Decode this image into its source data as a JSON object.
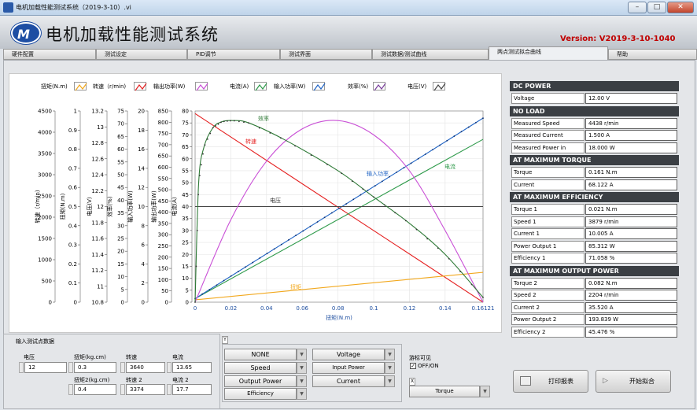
{
  "window": {
    "title": "电机加载性能测试系统（2019-3-10）.vi"
  },
  "header": {
    "title": "电机加载性能测试系统",
    "version": "Version: V2019-3-10-1040"
  },
  "tabs": [
    "硬件配置",
    "测试设定",
    "PID调节",
    "测试界面",
    "测试数据/测试曲线",
    "两点测试拟合曲线",
    "帮助"
  ],
  "legend": [
    "扭矩(N.m)",
    "转速（r/min)",
    "输出功率(W)",
    "电流(A)",
    "输入功率(W)",
    "效率(%)",
    "电压(V)"
  ],
  "axes": [
    {
      "label": "转速（r/min)",
      "ticks": [
        "4500",
        "4000",
        "3500",
        "3000",
        "2500",
        "2000",
        "1500",
        "1000",
        "500",
        "0"
      ]
    },
    {
      "label": "扭矩(N.m)",
      "ticks": [
        "1",
        "0.9",
        "0.8",
        "0.7",
        "0.6",
        "0.5",
        "0.4",
        "0.3",
        "0.2",
        "0.1",
        "0"
      ]
    },
    {
      "label": "电压(V)",
      "ticks": [
        "13.2",
        "13",
        "12.8",
        "12.6",
        "12.4",
        "12.2",
        "12",
        "11.8",
        "11.6",
        "11.4",
        "11.2",
        "11",
        "10.8"
      ]
    },
    {
      "label": "效率(%)",
      "ticks": [
        "75",
        "70",
        "65",
        "60",
        "55",
        "50",
        "45",
        "40",
        "35",
        "30",
        "25",
        "20",
        "15",
        "10",
        "5",
        "0"
      ]
    },
    {
      "label": "输入功率(W)",
      "ticks": [
        "20",
        "18",
        "16",
        "14",
        "12",
        "10",
        "8",
        "6",
        "4",
        "2",
        "0"
      ]
    },
    {
      "label": "输出功率(W)",
      "ticks": [
        "850",
        "800",
        "750",
        "700",
        "650",
        "600",
        "550",
        "500",
        "450",
        "400",
        "350",
        "300",
        "250",
        "200",
        "150",
        "100",
        "50",
        "0"
      ]
    },
    {
      "label": "电流(A)",
      "ticks": [
        "80",
        "75",
        "70",
        "65",
        "60",
        "55",
        "50",
        "45",
        "40",
        "35",
        "30",
        "25",
        "20",
        "15",
        "10",
        "5",
        "0"
      ]
    }
  ],
  "chart_data": {
    "type": "line",
    "xlabel": "扭矩(N.m)",
    "x_ticks": [
      "0",
      "0.02",
      "0.04",
      "0.06",
      "0.08",
      "0.1",
      "0.12",
      "0.14",
      "0.16121"
    ],
    "xlim": [
      0,
      0.16121
    ],
    "curve_labels": {
      "efficiency": "效率",
      "speed": "转速",
      "voltage": "电压",
      "input_power": "输入功率",
      "current": "电流",
      "torque": "扭矩"
    },
    "series": [
      {
        "key": "speed",
        "color": "#e52020",
        "axis": "转速（r/min)",
        "x": [
          0,
          0.16121
        ],
        "y": [
          4438,
          0
        ]
      },
      {
        "key": "current",
        "color": "#2e9a4a",
        "axis": "电流(A)",
        "x": [
          0,
          0.16121
        ],
        "y": [
          1.5,
          68.122
        ]
      },
      {
        "key": "input_power",
        "color": "#1f63c4",
        "axis": "电流(A)",
        "x": [
          0,
          0.16121
        ],
        "y": [
          1.5,
          77
        ]
      },
      {
        "key": "voltage",
        "color": "#444444",
        "axis": "电流(A)",
        "x": [
          0,
          0.16121
        ],
        "y": [
          40,
          40
        ]
      },
      {
        "key": "torque",
        "color": "#f2a81d",
        "axis": "电流(A)",
        "x": [
          0,
          0.16121
        ],
        "y": [
          1,
          12.5
        ]
      },
      {
        "key": "output_power",
        "color": "#c94fd6",
        "axis": "电流(A)",
        "x": [
          0,
          0.02,
          0.04,
          0.06,
          0.08,
          0.1,
          0.12,
          0.14,
          0.16121
        ],
        "y": [
          0,
          34.5,
          59,
          72.5,
          76,
          70,
          55,
          30,
          0
        ]
      },
      {
        "key": "efficiency",
        "color": "#2f7a37",
        "axis": "电流(A)",
        "x": [
          0,
          0.002,
          0.005,
          0.01,
          0.015,
          0.021,
          0.03,
          0.05,
          0.08,
          0.1,
          0.12,
          0.14,
          0.16121
        ],
        "y": [
          0,
          50,
          65,
          73,
          75.5,
          76,
          75,
          68,
          55,
          44,
          33,
          20,
          2
        ]
      }
    ]
  },
  "results": {
    "dc_power": {
      "head": "DC POWER",
      "rows": [
        [
          "Voltage",
          "12.00 V"
        ]
      ]
    },
    "no_load": {
      "head": "NO LOAD",
      "rows": [
        [
          "Measured Speed",
          "4438 r/min"
        ],
        [
          "Measured Current",
          "1.500 A"
        ],
        [
          "Measured Power in",
          "18.000 W"
        ]
      ]
    },
    "max_torque": {
      "head": "AT MAXIMUM TORQUE",
      "rows": [
        [
          "Torque",
          "0.161 N.m"
        ],
        [
          "Current",
          "68.122 A"
        ]
      ]
    },
    "max_eff": {
      "head": "AT MAXIMUM EFFICIENCY",
      "rows": [
        [
          "Torque 1",
          "0.021 N.m"
        ],
        [
          "Speed 1",
          "3879  r/min"
        ],
        [
          "Current 1",
          "10.005 A"
        ],
        [
          "Power Output 1",
          "85.312 W"
        ],
        [
          "Efficiency 1",
          "71.058 %"
        ]
      ]
    },
    "max_power": {
      "head": "AT MAXIMUM OUTPUT POWER",
      "rows": [
        [
          "Torque 2",
          "0.082 N.m"
        ],
        [
          "Speed 2",
          "2204  r/min"
        ],
        [
          "Current 2",
          "35.520 A"
        ],
        [
          "Power Output 2",
          "193.839 W"
        ],
        [
          "Efficiency 2",
          "45.476 %"
        ]
      ]
    }
  },
  "inputs": {
    "section": "输入测试点数据",
    "voltage_label": "电压",
    "voltage": "12",
    "torque_label": "扭矩(kg.cm)",
    "torque": "0.3",
    "speed_label": "转速",
    "speed": "3640",
    "current_label": "电流",
    "current": "13.65",
    "torque2_label": "扭矩2(kg.cm)",
    "torque2": "0.4",
    "speed2_label": "转速 2",
    "speed2": "3374",
    "current2_label": "电流 2",
    "current2": "17.7"
  },
  "y_selector": {
    "label": "Y",
    "left": [
      "NONE",
      "Speed",
      "Output Power",
      "Efficiency"
    ],
    "right": [
      "Voltage",
      "Input Power",
      "Current"
    ]
  },
  "cursor": {
    "label": "游标可见",
    "onoff": "OFF/ON",
    "x_label": "X",
    "x_value": "Torque"
  },
  "buttons": {
    "print": "打印报表",
    "fit": "开始拟合"
  }
}
